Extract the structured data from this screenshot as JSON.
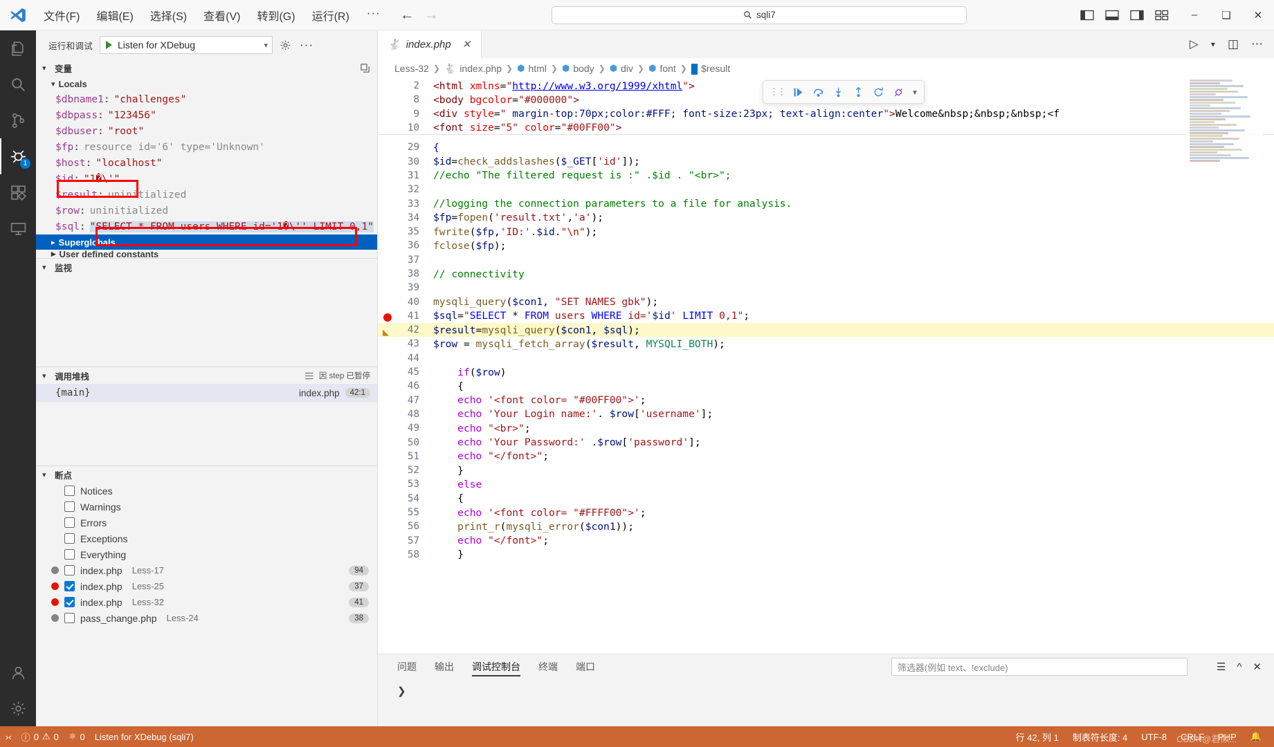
{
  "titlebar": {
    "menus": [
      "文件(F)",
      "编辑(E)",
      "选择(S)",
      "查看(V)",
      "转到(G)",
      "运行(R)"
    ],
    "more": "···",
    "back_icon": "arrow-left-icon",
    "forward_icon": "arrow-right-icon",
    "search_value": "sqli7",
    "search_icon": "search-icon",
    "minimize": "–",
    "maximize": "❑",
    "close": "✕"
  },
  "activitybar": {
    "items": [
      {
        "name": "explorer",
        "icon": "files-icon",
        "badge": ""
      },
      {
        "name": "search",
        "icon": "search-icon",
        "badge": ""
      },
      {
        "name": "source-control",
        "icon": "source-control-icon",
        "badge": ""
      },
      {
        "name": "run-and-debug",
        "icon": "debug-icon",
        "badge": "1"
      },
      {
        "name": "extensions",
        "icon": "extensions-icon",
        "badge": ""
      },
      {
        "name": "remote",
        "icon": "remote-explorer-icon",
        "badge": ""
      }
    ],
    "bottom": [
      {
        "name": "accounts",
        "icon": "account-icon"
      },
      {
        "name": "settings",
        "icon": "gear-icon"
      }
    ]
  },
  "sidebar": {
    "title": "运行和调试",
    "launch_config": "Listen for XDebug",
    "gear_icon": "gear-icon",
    "more_icon": "more-actions-icon",
    "variables": {
      "header": "变量",
      "scopes": [
        {
          "name": "Locals",
          "expanded": true,
          "rows": [
            {
              "name": "$dbname1",
              "value": "\"challenges\"",
              "kind": "string"
            },
            {
              "name": "$dbpass",
              "value": "\"123456\"",
              "kind": "string"
            },
            {
              "name": "$dbuser",
              "value": "\"root\"",
              "kind": "string"
            },
            {
              "name": "$fp",
              "value": "resource id='6' type='Unknown'",
              "kind": "resource"
            },
            {
              "name": "$host",
              "value": "\"localhost\"",
              "kind": "string"
            },
            {
              "name": "$id",
              "value": "\"1�\\'\"",
              "kind": "string",
              "highlighted": true
            },
            {
              "name": "$result",
              "value": "uninitialized",
              "kind": "uninit"
            },
            {
              "name": "$row",
              "value": "uninitialized",
              "kind": "uninit"
            },
            {
              "name": "$sql",
              "value": "\"SELECT * FROM users WHERE id='1�\\'' LIMIT 0,1\"",
              "kind": "string",
              "highlighted": true,
              "selected": true
            }
          ]
        },
        {
          "name": "Superglobals",
          "expanded": false,
          "selected": true
        },
        {
          "name": "User defined constants",
          "expanded": false
        }
      ]
    },
    "watch": {
      "header": "监视"
    },
    "callstack": {
      "header": "调用堆栈",
      "status": "因 step 已暂停",
      "threads_icon": "threads-icon",
      "frames": [
        {
          "name": "{main}",
          "file": "index.php",
          "position": "42:1"
        }
      ]
    },
    "breakpoints": {
      "header": "断点",
      "categories": [
        {
          "label": "Notices",
          "checked": false
        },
        {
          "label": "Warnings",
          "checked": false
        },
        {
          "label": "Errors",
          "checked": false
        },
        {
          "label": "Exceptions",
          "checked": false
        },
        {
          "label": "Everything",
          "checked": false
        }
      ],
      "files": [
        {
          "label": "index.php",
          "sub": "Less-17",
          "checked": false,
          "dot": "grey",
          "badge": "94"
        },
        {
          "label": "index.php",
          "sub": "Less-25",
          "checked": true,
          "dot": "red",
          "badge": "37"
        },
        {
          "label": "index.php",
          "sub": "Less-32",
          "checked": true,
          "dot": "red",
          "badge": "41"
        },
        {
          "label": "pass_change.php",
          "sub": "Less-24",
          "checked": false,
          "dot": "grey",
          "badge": "38"
        }
      ]
    }
  },
  "editor": {
    "tab": {
      "label": "index.php",
      "icon": "php-icon",
      "close_icon": "close-icon"
    },
    "tab_actions": [
      {
        "name": "run-file",
        "icon": "play-icon"
      },
      {
        "name": "run-chevron",
        "icon": "chevron-down-icon"
      },
      {
        "name": "split-editor",
        "icon": "split-editor-icon"
      },
      {
        "name": "more-actions",
        "icon": "more-actions-icon"
      }
    ],
    "breadcrumb": [
      {
        "label": "Less-32",
        "icon": ""
      },
      {
        "label": "index.php",
        "icon": "php-icon"
      },
      {
        "label": "html",
        "icon": "symbol-cube-icon"
      },
      {
        "label": "body",
        "icon": "symbol-cube-icon"
      },
      {
        "label": "div",
        "icon": "symbol-cube-icon"
      },
      {
        "label": "font",
        "icon": "symbol-cube-icon"
      },
      {
        "label": "$result",
        "icon": "symbol-variable-icon"
      }
    ],
    "debug_toolbar": [
      {
        "name": "drag-handle",
        "icon": "grip-icon"
      },
      {
        "name": "continue",
        "icon": "continue-icon"
      },
      {
        "name": "step-over",
        "icon": "step-over-icon"
      },
      {
        "name": "step-into",
        "icon": "step-into-icon"
      },
      {
        "name": "step-out",
        "icon": "step-out-icon"
      },
      {
        "name": "restart",
        "icon": "restart-icon"
      },
      {
        "name": "disconnect",
        "icon": "disconnect-icon"
      },
      {
        "name": "toolbar-chevron",
        "icon": "chevron-down-icon"
      }
    ],
    "sticky_lines": [
      {
        "num": "2",
        "text": "<html xmlns=\"http://www.w3.org/1999/xhtml\">"
      },
      {
        "num": "8",
        "text": "<body bgcolor=\"#000000\">"
      },
      {
        "num": "9",
        "text": "<div style=\" margin-top:70px;color:#FFF; font-size:23px; text-align:center\">Welcome&nbsp;&nbsp;&nbsp;<f"
      },
      {
        "num": "10",
        "text": "<font size=\"5\" color=\"#00FF00\">"
      }
    ],
    "lines": [
      {
        "num": "29",
        "text": "{"
      },
      {
        "num": "30",
        "text": "$id=check_addslashes($_GET['id']);"
      },
      {
        "num": "31",
        "text": "//echo \"The filtered request is :\" .$id . \"<br>\";"
      },
      {
        "num": "32",
        "text": ""
      },
      {
        "num": "33",
        "text": "//logging the connection parameters to a file for analysis."
      },
      {
        "num": "34",
        "text": "$fp=fopen('result.txt','a');"
      },
      {
        "num": "35",
        "text": "fwrite($fp,'ID:'.$id.\"\\n\");"
      },
      {
        "num": "36",
        "text": "fclose($fp);"
      },
      {
        "num": "37",
        "text": ""
      },
      {
        "num": "38",
        "text": "// connectivity"
      },
      {
        "num": "39",
        "text": ""
      },
      {
        "num": "40",
        "text": "mysqli_query($con1, \"SET NAMES gbk\");"
      },
      {
        "num": "41",
        "text": "$sql=\"SELECT * FROM users WHERE id='$id' LIMIT 0,1\";",
        "breakpoint": true
      },
      {
        "num": "42",
        "text": "$result=mysqli_query($con1, $sql);",
        "current": true
      },
      {
        "num": "43",
        "text": "$row = mysqli_fetch_array($result, MYSQLI_BOTH);"
      },
      {
        "num": "44",
        "text": ""
      },
      {
        "num": "45",
        "text": "    if($row)"
      },
      {
        "num": "46",
        "text": "    {"
      },
      {
        "num": "47",
        "text": "    echo '<font color= \"#00FF00\">';"
      },
      {
        "num": "48",
        "text": "    echo 'Your Login name:'. $row['username'];"
      },
      {
        "num": "49",
        "text": "    echo \"<br>\";"
      },
      {
        "num": "50",
        "text": "    echo 'Your Password:' .$row['password'];"
      },
      {
        "num": "51",
        "text": "    echo \"</font>\";"
      },
      {
        "num": "52",
        "text": "    }"
      },
      {
        "num": "53",
        "text": "    else"
      },
      {
        "num": "54",
        "text": "    {"
      },
      {
        "num": "55",
        "text": "    echo '<font color= \"#FFFF00\">';"
      },
      {
        "num": "56",
        "text": "    print_r(mysqli_error($con1));"
      },
      {
        "num": "57",
        "text": "    echo \"</font>\";"
      },
      {
        "num": "58",
        "text": "    }"
      }
    ]
  },
  "panel": {
    "tabs": [
      {
        "label": "问题",
        "active": false
      },
      {
        "label": "输出",
        "active": false
      },
      {
        "label": "调试控制台",
        "active": true
      },
      {
        "label": "终端",
        "active": false
      },
      {
        "label": "端口",
        "active": false
      }
    ],
    "filter_placeholder": "筛选器(例如 text、!exclude)",
    "tools": [
      {
        "name": "clear-console",
        "icon": "clear-icon"
      },
      {
        "name": "maximize-panel",
        "icon": "chevron-up-icon"
      },
      {
        "name": "close-panel",
        "icon": "close-icon"
      }
    ],
    "prompt": "❯"
  },
  "statusbar": {
    "remote_icon": "remote-icon",
    "errors": "0",
    "warnings": "0",
    "ports": "0",
    "debug_session": "Listen for XDebug (sqli7)",
    "cursor": "行 42, 列 1",
    "indent": "制表符长度: 4",
    "encoding": "UTF-8",
    "eol": "CRLF",
    "language": "PHP",
    "bell_icon": "bell-icon",
    "watermark": "CSDN@君似..."
  },
  "colors": {
    "status_bar": "#cc6633",
    "accent_blue": "#0060c0",
    "breakpoint_red": "#e51400",
    "highlight_box": "#ff0000",
    "current_line": "#fdf9c8"
  }
}
